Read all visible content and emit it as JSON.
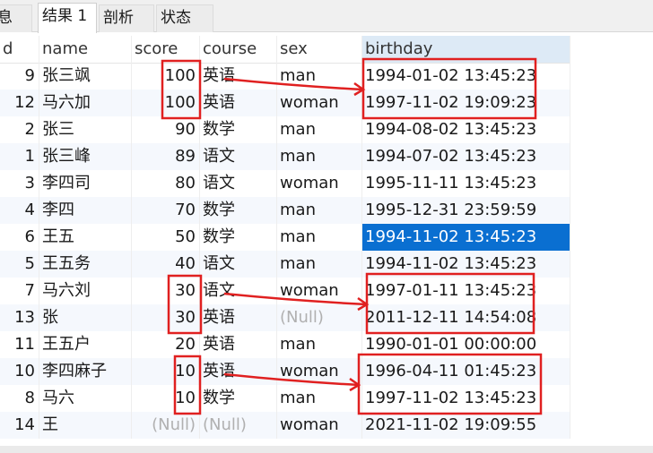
{
  "tabs": [
    {
      "label": "息",
      "active": false
    },
    {
      "label": "结果 1",
      "active": true
    },
    {
      "label": "剖析",
      "active": false
    },
    {
      "label": "状态",
      "active": false
    }
  ],
  "columns": [
    "d",
    "name",
    "score",
    "course",
    "sex",
    "birthday"
  ],
  "rows": [
    {
      "id": "9",
      "name": "张三飒",
      "score": "100",
      "course": "英语",
      "sex": "man",
      "birthday": "1994-01-02 13:45:23"
    },
    {
      "id": "12",
      "name": "马六加",
      "score": "100",
      "course": "英语",
      "sex": "woman",
      "birthday": "1997-11-02 19:09:23"
    },
    {
      "id": "2",
      "name": "张三",
      "score": "90",
      "course": "数学",
      "sex": "man",
      "birthday": "1994-08-02 13:45:23"
    },
    {
      "id": "1",
      "name": "张三峰",
      "score": "89",
      "course": "语文",
      "sex": "man",
      "birthday": "1994-07-02 13:45:23"
    },
    {
      "id": "3",
      "name": "李四司",
      "score": "80",
      "course": "语文",
      "sex": "woman",
      "birthday": "1995-11-11 13:45:23"
    },
    {
      "id": "4",
      "name": "李四",
      "score": "70",
      "course": "数学",
      "sex": "man",
      "birthday": "1995-12-31 23:59:59"
    },
    {
      "id": "6",
      "name": "王五",
      "score": "50",
      "course": "数学",
      "sex": "man",
      "birthday": "1994-11-02 13:45:23"
    },
    {
      "id": "5",
      "name": "王五务",
      "score": "40",
      "course": "语文",
      "sex": "man",
      "birthday": "1994-11-02 13:45:23"
    },
    {
      "id": "7",
      "name": "马六刘",
      "score": "30",
      "course": "语文",
      "sex": "woman",
      "birthday": "1997-01-11 13:45:23"
    },
    {
      "id": "13",
      "name": "张",
      "score": "30",
      "course": "英语",
      "sex": "(Null)",
      "birthday": "2011-12-11 14:54:08"
    },
    {
      "id": "11",
      "name": "王五户",
      "score": "20",
      "course": "英语",
      "sex": "man",
      "birthday": "1990-01-01 00:00:00"
    },
    {
      "id": "10",
      "name": "李四麻子",
      "score": "10",
      "course": "英语",
      "sex": "woman",
      "birthday": "1996-04-11 01:45:23"
    },
    {
      "id": "8",
      "name": "马六",
      "score": "10",
      "course": "数学",
      "sex": "man",
      "birthday": "1997-11-02 13:45:23"
    },
    {
      "id": "14",
      "name": "王",
      "score": "(Null)",
      "course": "(Null)",
      "sex": "woman",
      "birthday": "2021-11-02 19:09:55"
    }
  ],
  "selected_cell": {
    "row": 6,
    "column": "birthday"
  },
  "null_text": "(Null)",
  "colors": {
    "selection": "#0a6fd1",
    "header_highlight": "#ddeaf6",
    "annotation": "#e02020",
    "null_text": "#b0b0b0"
  },
  "annotations": {
    "score_boxes_rows": [
      [
        0,
        1
      ],
      [
        8,
        9
      ],
      [
        11,
        12
      ]
    ],
    "birthday_boxes_rows": [
      [
        0,
        1
      ],
      [
        8,
        9
      ],
      [
        11,
        12
      ]
    ]
  }
}
